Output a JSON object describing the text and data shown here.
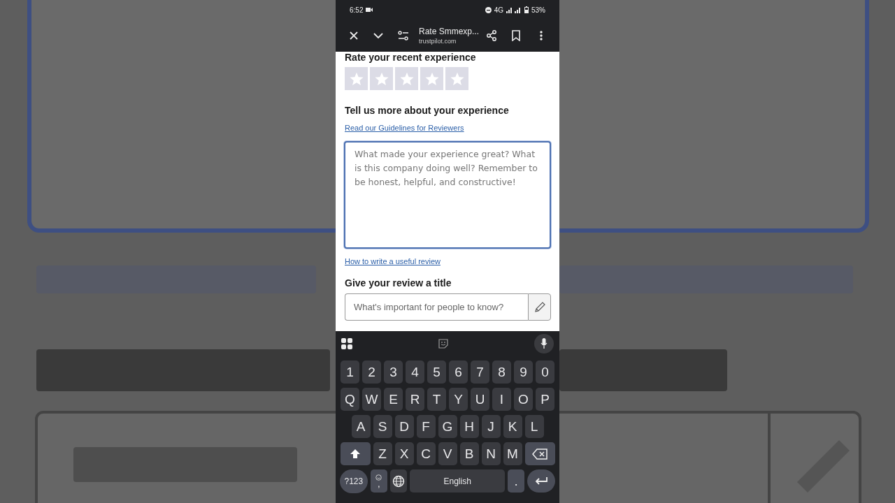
{
  "status_bar": {
    "time": "6:52",
    "network": "4G",
    "battery": "53%"
  },
  "browser_bar": {
    "title": "Rate Smmexp...",
    "url": "trustpilot.com"
  },
  "rating": {
    "heading": "Rate your recent experience",
    "stars": 0
  },
  "review": {
    "heading": "Tell us more about your experience",
    "guidelines_link": "Read our Guidelines for Reviewers",
    "placeholder": "What made your experience great? What is this company doing well? Remember to be honest, helpful, and constructive!",
    "focused": true,
    "help_link": "How to write a useful review"
  },
  "title_field": {
    "heading": "Give your review a title",
    "placeholder": "What's important for people to know?"
  },
  "keyboard": {
    "rows": [
      [
        "1",
        "2",
        "3",
        "4",
        "5",
        "6",
        "7",
        "8",
        "9",
        "0"
      ],
      [
        "Q",
        "W",
        "E",
        "R",
        "T",
        "Y",
        "U",
        "I",
        "O",
        "P"
      ],
      [
        "A",
        "S",
        "D",
        "F",
        "G",
        "H",
        "J",
        "K",
        "L"
      ],
      [
        "Z",
        "X",
        "C",
        "V",
        "B",
        "N",
        "M"
      ]
    ],
    "symbols_key": "?123",
    "comma_key": ",",
    "space_key": "English",
    "period_key": "."
  }
}
